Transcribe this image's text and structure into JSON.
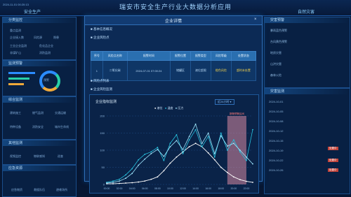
{
  "header": {
    "time": "2024-11-01 00:20:13",
    "title": "瑞安市安全生产行业大数据分析应用",
    "left_tab": "安全生产",
    "right_tab": "自然灾害"
  },
  "left": {
    "p1_title": "分类监控",
    "p1_sub": "重点监测",
    "p1_items": [
      "企业接入数",
      "风险源",
      "隐患"
    ],
    "p1_rows": [
      "工业企业监测",
      "危化品企业",
      "非煤矿山",
      "消防监测"
    ],
    "p2_title": "监测预警",
    "p2_center": "预警",
    "p3_title": "综合监测",
    "p3_items": [
      "建筑施工",
      "燃气监测",
      "交通运输",
      "特种设备",
      "消防安全",
      "城市生命线"
    ],
    "p4_title": "其他监测",
    "p4_items": [
      "视频监控",
      "物联感知",
      "巡查"
    ],
    "p5_title": "应急资源",
    "p5_items": [
      "应急物资",
      "救援队伍",
      "避难场所"
    ]
  },
  "right": {
    "p1_title": "灾害预警",
    "p1_rows": [
      "暴雨蓝色预警",
      "台风黄色预警",
      "地质灾害",
      "山洪灾害",
      "森林火险"
    ],
    "p2_title": "灾害监测",
    "p2_rows": [
      "2024-10-01",
      "2024-10-05",
      "2024-10-08",
      "2024-10-12",
      "2024-10-15",
      "2024-10-19",
      "2024-10-22",
      "2024-10-26"
    ],
    "badges": [
      "处置中",
      "处置中",
      "处置中"
    ]
  },
  "modal": {
    "title": "企业详情",
    "close": "×",
    "sec1": "■ 基本信息概况",
    "sec2": "■ 企业风险点",
    "table_headers": [
      "序号",
      "风险点名称",
      "报警时间",
      "报警位置",
      "报警类型",
      "风险等级",
      "处置状态"
    ],
    "table_rows": [
      [
        "1",
        "二氧化碳",
        "2024-07-01 07:00:24",
        "储罐区",
        "液位超限",
        "橙色风险",
        "超时未处置"
      ]
    ],
    "sec3": "■ 风险点列表",
    "sec4": "■ 企业风险监测",
    "chart_title": "企业指标监测",
    "chart_filter": "近24小时 ▾"
  },
  "chart_data": {
    "type": "line",
    "categories": [
      "00:00",
      "01:00",
      "02:00",
      "03:00",
      "04:00",
      "05:00",
      "06:00",
      "07:00",
      "08:00",
      "09:00",
      "10:00",
      "11:00",
      "12:00",
      "13:00",
      "14:00",
      "15:00",
      "16:00",
      "17:00",
      "18:00",
      "19:00",
      "20:00",
      "21:00",
      "22:00",
      "23:00"
    ],
    "series": [
      {
        "name": "液位",
        "color": "#ffffff",
        "values": [
          2,
          2,
          3,
          4,
          5,
          7,
          10,
          15,
          22,
          40,
          62,
          80,
          95,
          110,
          120,
          110,
          92,
          72,
          50,
          35,
          22,
          14,
          9,
          6
        ]
      },
      {
        "name": "温度",
        "color": "#27c3e0",
        "values": [
          6,
          10,
          15,
          28,
          46,
          72,
          88,
          95,
          108,
          70,
          120,
          145,
          90,
          130,
          160,
          110,
          140,
          80,
          150,
          100,
          130,
          95,
          70,
          160
        ]
      },
      {
        "name": "压力",
        "color": "#9fe7ff",
        "values": [
          4,
          6,
          10,
          18,
          32,
          56,
          74,
          90,
          102,
          82,
          110,
          128,
          102,
          140,
          176,
          120,
          150,
          90,
          142,
          112,
          120,
          100,
          80,
          60
        ]
      }
    ],
    "ylim": [
      0,
      200
    ],
    "y_ticks": [
      "200",
      "150",
      "100",
      "50",
      "0"
    ],
    "highlight_label": "报警预警区间"
  },
  "colors": {
    "accent": "#2b8cff",
    "warn": "#c2433a",
    "gold": "#f2d14b"
  }
}
